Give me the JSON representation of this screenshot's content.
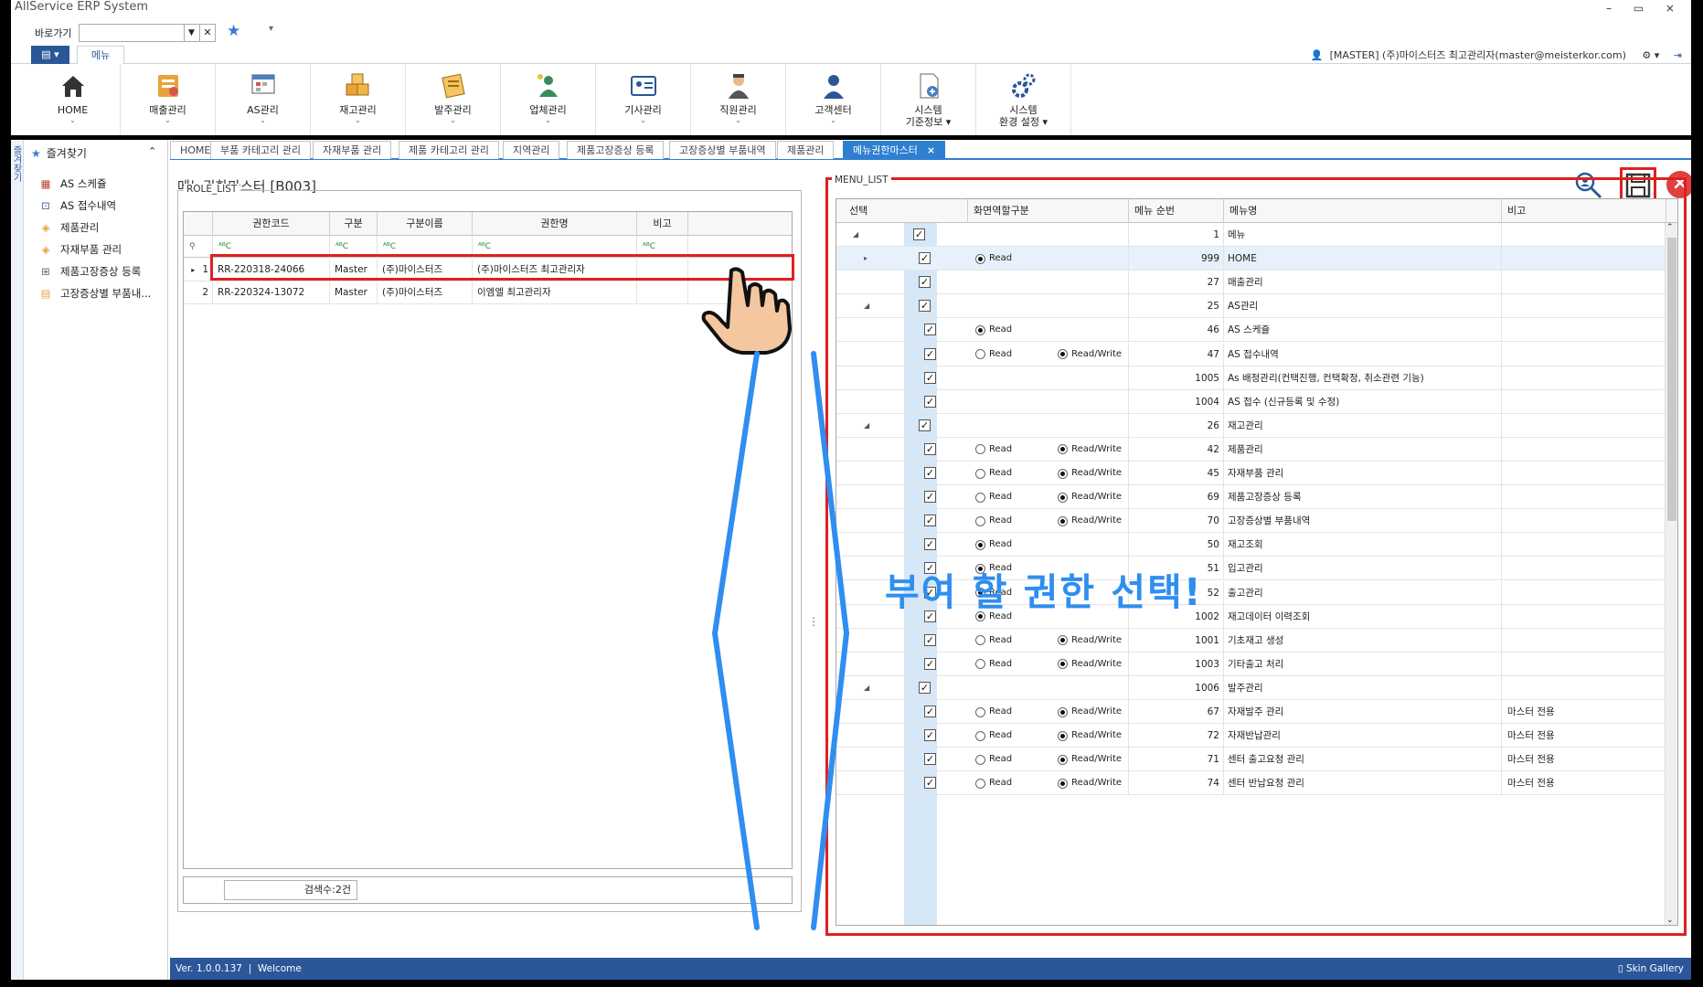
{
  "window": {
    "title": "AllService ERP System",
    "controls": "– ▭ ×"
  },
  "quickbar": {
    "label": "바로가기",
    "value": ""
  },
  "menutabs": {
    "app_button": "▤ ▾",
    "menu_tab": "메뉴"
  },
  "user": {
    "text": "[MASTER] (주)마이스터즈 최고관리자(master@meisterkor.com)"
  },
  "ribbon": [
    {
      "label": "HOME",
      "icon": "home-icon"
    },
    {
      "label": "매출관리",
      "icon": "sales-icon"
    },
    {
      "label": "AS관리",
      "icon": "as-icon"
    },
    {
      "label": "재고관리",
      "icon": "inventory-icon"
    },
    {
      "label": "발주관리",
      "icon": "order-icon"
    },
    {
      "label": "업체관리",
      "icon": "company-icon"
    },
    {
      "label": "기사관리",
      "icon": "technician-icon"
    },
    {
      "label": "직원관리",
      "icon": "employee-icon"
    },
    {
      "label": "고객센터",
      "icon": "customer-icon"
    },
    {
      "label": "시스템 기준정보",
      "label1": "시스템",
      "label2": "기준정보 ▾",
      "icon": "system-base-icon"
    },
    {
      "label": "시스템 환경 설정",
      "label1": "시스템",
      "label2": "환경 설정 ▾",
      "icon": "system-settings-icon"
    }
  ],
  "sidebar": {
    "strip": "즐겨찾기",
    "title": "즐겨찾기",
    "items": [
      {
        "label": "AS 스케쥴",
        "icon": "calendar-icon"
      },
      {
        "label": "AS 접수내역",
        "icon": "receipt-icon"
      },
      {
        "label": "제품관리",
        "icon": "box-icon"
      },
      {
        "label": "자재부품 관리",
        "icon": "parts-icon"
      },
      {
        "label": "제품고장증상 등록",
        "icon": "register-icon"
      },
      {
        "label": "고장증상별 부품내...",
        "icon": "clipboard-icon"
      }
    ]
  },
  "doctabs": [
    {
      "label": "HOME"
    },
    {
      "label": "부품 카테고리 관리"
    },
    {
      "label": "자재부품 관리"
    },
    {
      "label": "제품 카테고리 관리"
    },
    {
      "label": "지역관리"
    },
    {
      "label": "제품고장증상 등록"
    },
    {
      "label": "고장증상별 부품내역"
    },
    {
      "label": "제품관리"
    },
    {
      "label": "메뉴권한마스터",
      "close": "×"
    }
  ],
  "page": {
    "title": "메뉴권한마스터 [B003]"
  },
  "role_list": {
    "label": "ROLE_LIST",
    "columns": [
      "권한코드",
      "구분",
      "구분이름",
      "권한명",
      "비고"
    ],
    "filter_glyph": "ᴬᴮC",
    "rows": [
      {
        "no": "1",
        "code": "RR-220318-24066",
        "type": "Master",
        "type_name": "(주)마이스터즈",
        "role_name": "(주)마이스터즈 최고관리자",
        "note": ""
      },
      {
        "no": "2",
        "code": "RR-220324-13072",
        "type": "Master",
        "type_name": "(주)마이스터즈",
        "role_name": "이엠엘 최고관리자",
        "note": ""
      }
    ],
    "count": "검색수:2건"
  },
  "menu_list": {
    "label": "MENU_LIST",
    "columns": [
      "선택",
      "화면역할구분",
      "메뉴 순번",
      "메뉴명",
      "비고"
    ],
    "rows": [
      {
        "level": 0,
        "expand": "◢",
        "checked": true,
        "read": "",
        "rw": "",
        "seq": "1",
        "name": "메뉴",
        "note": ""
      },
      {
        "level": 1,
        "expand": "▸",
        "checked": true,
        "read": "on",
        "rw": "",
        "seq": "999",
        "name": "HOME",
        "note": "",
        "sel": true
      },
      {
        "level": 1,
        "expand": "",
        "checked": true,
        "read": "",
        "rw": "",
        "seq": "27",
        "name": "매출관리",
        "note": ""
      },
      {
        "level": 1,
        "expand": "◢",
        "checked": true,
        "read": "",
        "rw": "",
        "seq": "25",
        "name": "AS관리",
        "note": ""
      },
      {
        "level": 2,
        "expand": "",
        "checked": true,
        "read": "on",
        "rw": "",
        "seq": "46",
        "name": "AS 스케쥴",
        "note": ""
      },
      {
        "level": 2,
        "expand": "",
        "checked": true,
        "read": "off",
        "rw": "on",
        "seq": "47",
        "name": "AS 접수내역",
        "note": ""
      },
      {
        "level": 2,
        "expand": "",
        "checked": true,
        "read": "",
        "rw": "",
        "seq": "1005",
        "name": "As 배정관리(컨택진행, 컨택확정, 취소관련 기능)",
        "note": ""
      },
      {
        "level": 2,
        "expand": "",
        "checked": true,
        "read": "",
        "rw": "",
        "seq": "1004",
        "name": "AS 접수 (신규등록 및 수정)",
        "note": ""
      },
      {
        "level": 1,
        "expand": "◢",
        "checked": true,
        "read": "",
        "rw": "",
        "seq": "26",
        "name": "재고관리",
        "note": ""
      },
      {
        "level": 2,
        "expand": "",
        "checked": true,
        "read": "off",
        "rw": "on",
        "seq": "42",
        "name": "제품관리",
        "note": ""
      },
      {
        "level": 2,
        "expand": "",
        "checked": true,
        "read": "off",
        "rw": "on",
        "seq": "45",
        "name": "자재부품 관리",
        "note": ""
      },
      {
        "level": 2,
        "expand": "",
        "checked": true,
        "read": "off",
        "rw": "on",
        "seq": "69",
        "name": "제품고장증상 등록",
        "note": ""
      },
      {
        "level": 2,
        "expand": "",
        "checked": true,
        "read": "off",
        "rw": "on",
        "seq": "70",
        "name": "고장증상별 부품내역",
        "note": ""
      },
      {
        "level": 2,
        "expand": "",
        "checked": true,
        "read": "on",
        "rw": "",
        "seq": "50",
        "name": "재고조회",
        "note": ""
      },
      {
        "level": 2,
        "expand": "",
        "checked": true,
        "read": "on",
        "rw": "",
        "seq": "51",
        "name": "입고관리",
        "note": ""
      },
      {
        "level": 2,
        "expand": "",
        "checked": true,
        "read": "on",
        "rw": "",
        "seq": "52",
        "name": "출고관리",
        "note": ""
      },
      {
        "level": 2,
        "expand": "",
        "checked": true,
        "read": "on",
        "rw": "",
        "seq": "1002",
        "name": "재고데이터 이력조회",
        "note": ""
      },
      {
        "level": 2,
        "expand": "",
        "checked": true,
        "read": "off",
        "rw": "on",
        "seq": "1001",
        "name": "기초재고 생성",
        "note": ""
      },
      {
        "level": 2,
        "expand": "",
        "checked": true,
        "read": "off",
        "rw": "on",
        "seq": "1003",
        "name": "기타출고 처리",
        "note": ""
      },
      {
        "level": 1,
        "expand": "◢",
        "checked": true,
        "read": "",
        "rw": "",
        "seq": "1006",
        "name": "발주관리",
        "note": ""
      },
      {
        "level": 2,
        "expand": "",
        "checked": true,
        "read": "off",
        "rw": "on",
        "seq": "67",
        "name": "자재발주 관리",
        "note": "마스터 전용"
      },
      {
        "level": 2,
        "expand": "",
        "checked": true,
        "read": "off",
        "rw": "on",
        "seq": "72",
        "name": "자재반납관리",
        "note": "마스터 전용"
      },
      {
        "level": 2,
        "expand": "",
        "checked": true,
        "read": "off",
        "rw": "on",
        "seq": "71",
        "name": "센터 출고요청 관리",
        "note": "마스터 전용"
      },
      {
        "level": 2,
        "expand": "",
        "checked": true,
        "read": "off",
        "rw": "on",
        "seq": "74",
        "name": "센터 반납요청 관리",
        "note": "마스터 전용"
      }
    ],
    "read_label": "Read",
    "rw_label": "Read/Write"
  },
  "annotation": {
    "text": "부여 할 권한 선택!"
  },
  "status": {
    "version": "Ver. 1.0.0.137",
    "welcome": "Welcome",
    "skin": "Skin Gallery"
  },
  "colors": {
    "accent": "#2f7fd1",
    "highlight_red": "#e02020",
    "annotation_blue": "#2f8ef0",
    "status_bar": "#2b579a"
  }
}
